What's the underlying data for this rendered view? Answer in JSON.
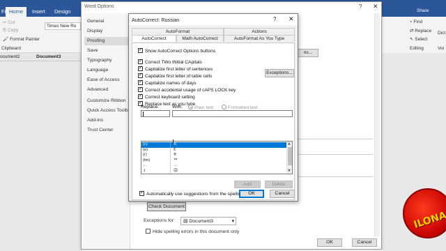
{
  "word": {
    "ribbon_tabs": [
      "File",
      "Home",
      "Insert",
      "Design"
    ],
    "active_tab": "Home",
    "clipboard": {
      "cut": "Cut",
      "copy": "Copy",
      "format_painter": "Format Painter",
      "group_label": "Clipboard"
    },
    "font_name": "Times New Ro",
    "doc_tabs": [
      "ocument2",
      "Document3"
    ],
    "right_ribbon": {
      "share": "Share",
      "find": "Find",
      "replace": "Replace",
      "select": "Select",
      "editing": "Editing",
      "dict": "Dict",
      "voice": "Voi"
    }
  },
  "word_options": {
    "title": "Word Options",
    "nav": [
      "General",
      "Display",
      "Proofing",
      "Save",
      "Typography",
      "Language",
      "Ease of Access",
      "Advanced",
      "Customize Ribbon",
      "Quick Access Toolbar",
      "Add-ins",
      "Trust Center"
    ],
    "selected_nav": "Proofing",
    "check_document": "Check Document",
    "exceptions_for_label": "Exceptions for:",
    "exceptions_for_value": "Document3",
    "hide_spelling": "Hide spelling errors in this document only",
    "ok": "OK",
    "cancel": "Cancel",
    "behind_button": "ns..."
  },
  "autocorrect": {
    "title": "AutoCorrect: Russian",
    "tabs_top": [
      "AutoFormat",
      "Actions"
    ],
    "tabs_bottom": [
      "AutoCorrect",
      "Math AutoCorrect",
      "AutoFormat As You Type"
    ],
    "active_tab": "AutoCorrect",
    "options": {
      "show_buttons": "Show AutoCorrect Options buttons",
      "two_initial": "Correct TWo INitial CApitals",
      "first_sentence": "Capitalize first letter of sentences",
      "first_table": "Capitalize first letter of table cells",
      "days": "Capitalize names of days",
      "caps_lock": "Correct accidental usage of cAPS LOCK key",
      "keyboard": "Correct keyboard setting",
      "replace_text": "Replace text as you type"
    },
    "exceptions_button": "Exceptions...",
    "replace_label": "Replace:",
    "with_label": "With:",
    "plain_text": "Plain text",
    "formatted_text": "Formatted text",
    "replace_value": "",
    "with_value": "",
    "entries": [
      {
        "replace": "(c)",
        "with": "©",
        "selected": true
      },
      {
        "replace": "(e)",
        "with": "€",
        "selected": false
      },
      {
        "replace": "(r)",
        "with": "®",
        "selected": false
      },
      {
        "replace": "(tm)",
        "with": "™",
        "selected": false
      },
      {
        "replace": "...",
        "with": "…",
        "selected": false
      },
      {
        "replace": ":(",
        "with": "☹",
        "selected": false
      }
    ],
    "add": "Add",
    "delete": "Delete",
    "auto_suggest": "Automatically use suggestions from the spelling checker",
    "ok": "OK",
    "cancel": "Cancel"
  },
  "logo": {
    "text": "ILONA MARK"
  },
  "colors": {
    "word_blue": "#2b579a",
    "selection": "#0078d7"
  }
}
